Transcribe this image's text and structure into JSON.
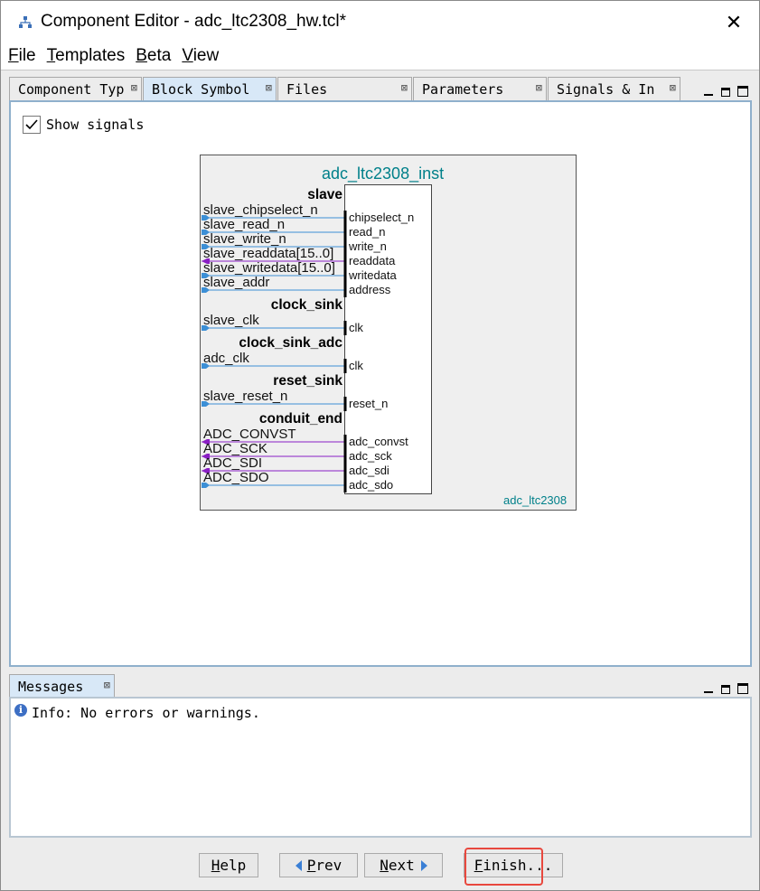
{
  "window": {
    "title": "Component Editor - adc_ltc2308_hw.tcl*",
    "close_glyph": "✕",
    "app_icon": "hierarchy-icon"
  },
  "menubar": {
    "items": [
      {
        "label": "File",
        "mnemonic": "F"
      },
      {
        "label": "Templates",
        "mnemonic": "T"
      },
      {
        "label": "Beta",
        "mnemonic": "B"
      },
      {
        "label": "View",
        "mnemonic": "V"
      }
    ]
  },
  "editor_tabs": [
    {
      "label": "Component Typ",
      "close": "⊠",
      "active": false
    },
    {
      "label": "Block Symbol",
      "close": "⊠",
      "active": true
    },
    {
      "label": "Files",
      "close": "⊠",
      "active": false
    },
    {
      "label": "Parameters",
      "close": "⊠",
      "active": false
    },
    {
      "label": "Signals & In",
      "close": "⊠",
      "active": false
    }
  ],
  "block_symbol": {
    "show_signals_label": "Show signals",
    "show_signals_checked": true,
    "instance_name": "adc_ltc2308_inst",
    "component_name": "adc_ltc2308",
    "interfaces": [
      {
        "name": "slave",
        "signals": [
          "slave_chipselect_n",
          "slave_read_n",
          "slave_write_n",
          "slave_readdata[15..0]",
          "slave_writedata[15..0]",
          "slave_addr"
        ],
        "ports": [
          "chipselect_n",
          "read_n",
          "write_n",
          "readdata",
          "writedata",
          "address"
        ]
      },
      {
        "name": "clock_sink",
        "signals": [
          "slave_clk"
        ],
        "ports": [
          "clk"
        ]
      },
      {
        "name": "clock_sink_adc",
        "signals": [
          "adc_clk"
        ],
        "ports": [
          "clk"
        ]
      },
      {
        "name": "reset_sink",
        "signals": [
          "slave_reset_n"
        ],
        "ports": [
          "reset_n"
        ]
      },
      {
        "name": "conduit_end",
        "signals": [
          "ADC_CONVST",
          "ADC_SCK",
          "ADC_SDI",
          "ADC_SDO"
        ],
        "ports": [
          "adc_convst",
          "adc_sck",
          "adc_sdi",
          "adc_sdo"
        ]
      }
    ],
    "wire_colors": {
      "input": "#3c8fd6",
      "output": "#8a1fc4"
    }
  },
  "messages": {
    "tab_label": "Messages",
    "tab_close": "⊠",
    "items": [
      {
        "level": "info",
        "text": "Info: No errors or warnings."
      }
    ]
  },
  "footer": {
    "help": {
      "pre": "",
      "ul": "H",
      "post": "elp"
    },
    "prev": {
      "pre": "",
      "ul": "P",
      "post": "rev"
    },
    "next": {
      "pre": "",
      "ul": "N",
      "post": "ext"
    },
    "finish": {
      "pre": "",
      "ul": "F",
      "post": "inish..."
    }
  }
}
